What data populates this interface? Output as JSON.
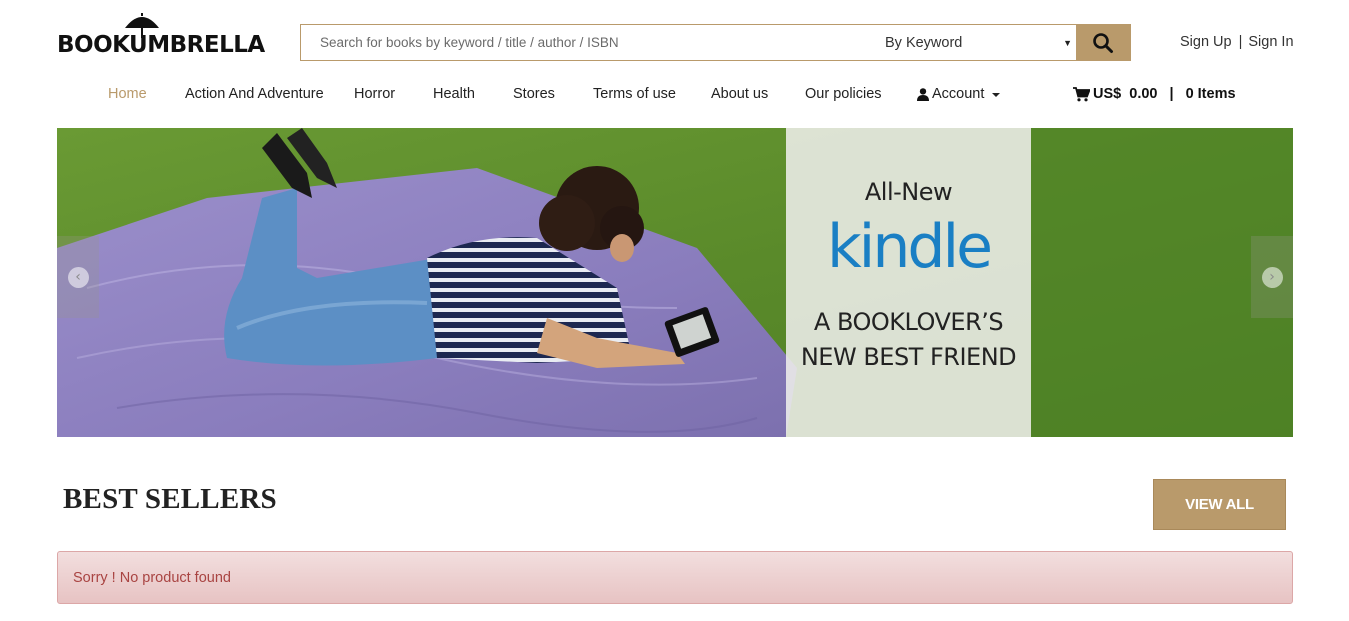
{
  "brand": {
    "logo_text": "BOOKUMBRELLA"
  },
  "search": {
    "placeholder": "Search for books by keyword / title / author / ISBN",
    "scope_selected": "By Keyword",
    "button_icon": "search-icon"
  },
  "auth": {
    "sign_up": "Sign Up",
    "separator": "|",
    "sign_in": "Sign In"
  },
  "nav": {
    "items": [
      {
        "label": "Home",
        "active": true
      },
      {
        "label": "Action And Adventure"
      },
      {
        "label": "Horror"
      },
      {
        "label": "Health"
      },
      {
        "label": "Stores"
      },
      {
        "label": "Terms of use"
      },
      {
        "label": "About us"
      },
      {
        "label": "Our policies"
      }
    ],
    "account": {
      "label": "Account",
      "icon": "user-icon"
    }
  },
  "cart": {
    "icon": "cart-icon",
    "amount": "US$  0.00",
    "separator": "|",
    "items": "0 Items"
  },
  "banner": {
    "promo": {
      "tagline": "All-New",
      "brand": "kindle",
      "line1": "A BOOKLOVER’S",
      "line2": "NEW BEST FRIEND"
    },
    "prev_icon": "chevron-left-icon",
    "next_icon": "chevron-right-icon",
    "prev_glyph": "‹",
    "next_glyph": "›"
  },
  "best_sellers": {
    "title": "BEST SELLERS",
    "view_all": "VIEW ALL",
    "empty_message": "Sorry ! No product found"
  },
  "colors": {
    "accent": "#b99a6b",
    "nav_active": "#b99a6b",
    "kindle_blue": "#1a7fc4",
    "alert_text": "#a94442",
    "alert_bg": "#f2dede"
  }
}
